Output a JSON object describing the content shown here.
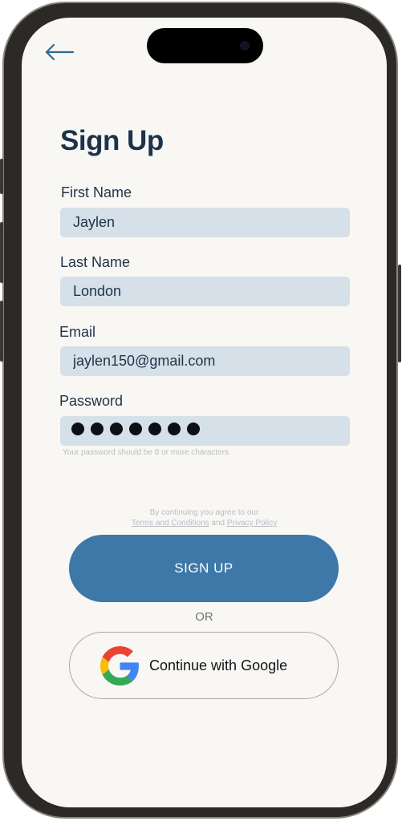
{
  "header": {
    "back_icon": "arrow-left-icon"
  },
  "page": {
    "title": "Sign Up"
  },
  "form": {
    "first_name": {
      "label": "First Name",
      "value": "Jaylen"
    },
    "last_name": {
      "label": "Last Name",
      "value": "London"
    },
    "email": {
      "label": "Email",
      "value": "jaylen150@gmail.com"
    },
    "password": {
      "label": "Password",
      "masked_length": 7,
      "hint": "Your password should be 8 or more characters"
    }
  },
  "terms": {
    "prefix": "By continuing you agree to our",
    "terms_link": "Terms and Conditions",
    "conjunction": "and",
    "privacy_link": "Privacy Policy"
  },
  "actions": {
    "signup_label": "SIGN UP",
    "or_label": "OR",
    "google_label": "Continue with Google",
    "google_icon": "google-icon"
  },
  "colors": {
    "primary": "#3d78a8",
    "heading": "#1d3349",
    "field_bg": "#d6e0e9",
    "screen_bg": "#f9f7f4"
  }
}
